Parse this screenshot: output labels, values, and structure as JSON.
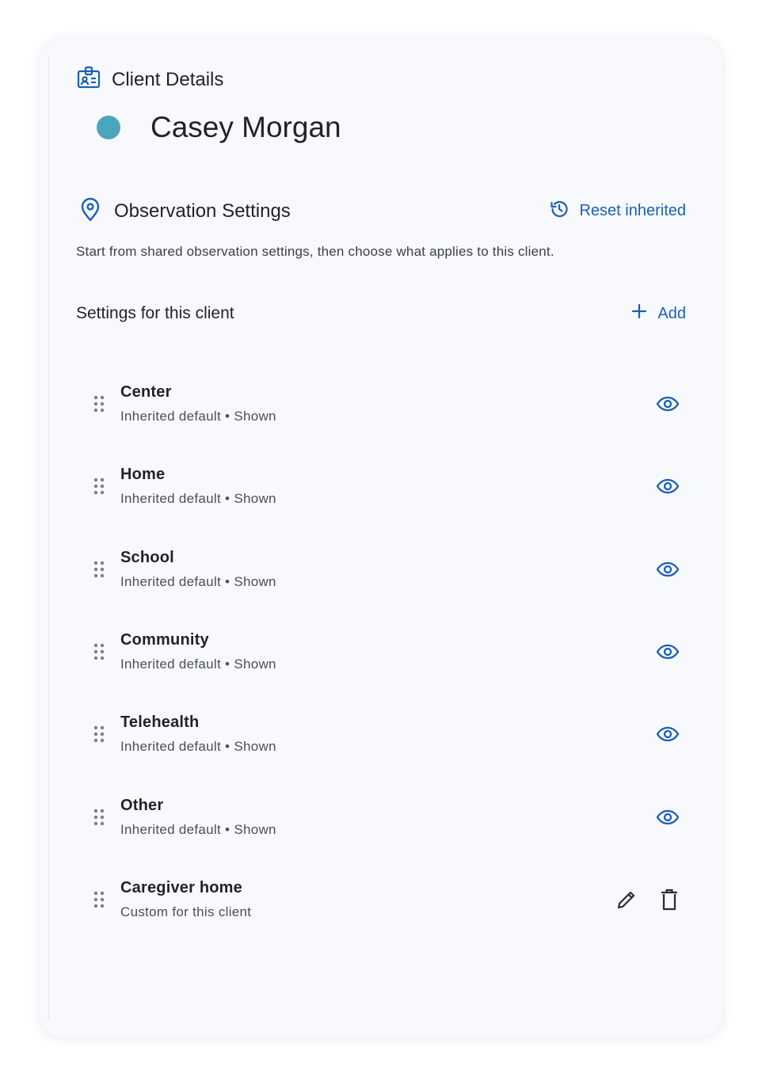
{
  "header": {
    "title": "Client Details",
    "icon": "id-badge-icon"
  },
  "client": {
    "name": "Casey Morgan",
    "color": "#4aa6ba"
  },
  "section": {
    "title": "Observation Settings",
    "reset_label": "Reset inherited",
    "description": "Start from shared observation settings, then choose what applies to this client."
  },
  "settings": {
    "title": "Settings for this client",
    "add_label": "Add"
  },
  "items": [
    {
      "label": "Center",
      "status": "Inherited default • Shown"
    },
    {
      "label": "Home",
      "status": "Inherited default • Shown"
    },
    {
      "label": "School",
      "status": "Inherited default • Shown"
    },
    {
      "label": "Community",
      "status": "Inherited default • Shown"
    },
    {
      "label": "Telehealth",
      "status": "Inherited default • Shown"
    },
    {
      "label": "Other",
      "status": "Inherited default • Shown"
    },
    {
      "label": "Caregiver home",
      "status": "Custom for this client"
    }
  ],
  "colors": {
    "accent": "#1b5fb5",
    "card_bg": "#f7f9fd"
  }
}
